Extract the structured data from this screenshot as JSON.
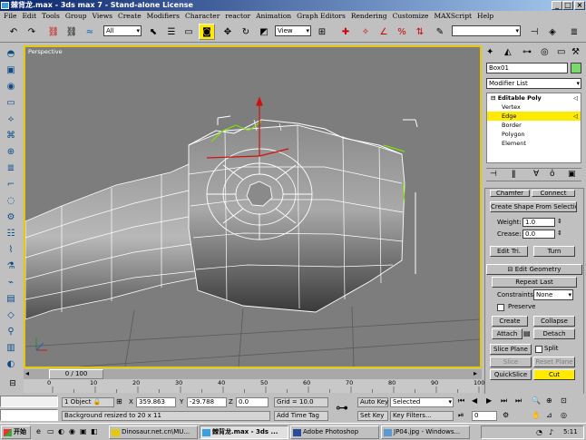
{
  "window": {
    "title": "棘背龙.max - 3ds max 7 - Stand-alone License",
    "min": "_",
    "max": "□",
    "close": "×"
  },
  "menu": [
    "File",
    "Edit",
    "Tools",
    "Group",
    "Views",
    "Create",
    "Modifiers",
    "Character",
    "reactor",
    "Animation",
    "Graph Editors",
    "Rendering",
    "Customize",
    "MAXScript",
    "Help"
  ],
  "toolbar": {
    "selection_filter": "All",
    "ref_coord": "View",
    "named_selection": ""
  },
  "viewport": {
    "label": "Perspective"
  },
  "panel": {
    "object_name": "Box01",
    "modifier_list": "Modifier List",
    "stack": {
      "root": "Editable Poly",
      "items": [
        "Vertex",
        "Edge",
        "Border",
        "Polygon",
        "Element"
      ],
      "active": "Edge"
    },
    "rollup_top": {
      "chamfer": "Chamfer",
      "connect": "Connect",
      "create_shape": "Create Shape From Selection",
      "weight_label": "Weight:",
      "weight_value": "1.0",
      "crease_label": "Crease:",
      "crease_value": "0.0",
      "edit_tri": "Edit Tri.",
      "turn": "Turn"
    },
    "edit_geometry": {
      "title": "Edit Geometry",
      "repeat_last": "Repeat Last",
      "constraints_label": "Constraints:",
      "constraints_value": "None",
      "preserve": "Preserve",
      "create": "Create",
      "collapse": "Collapse",
      "attach": "Attach",
      "detach": "Detach",
      "slice_plane": "Slice Plane",
      "split": "Split",
      "slice": "Slice",
      "reset_plane": "Reset Plane",
      "quickslice": "QuickSlice",
      "cut": "Cut"
    }
  },
  "timeline": {
    "frame": "0 / 100",
    "ticks": [
      "0",
      "10",
      "20",
      "30",
      "40",
      "50",
      "60",
      "70",
      "80",
      "90",
      "100"
    ]
  },
  "status": {
    "selected": "1 Object",
    "x_label": "X",
    "x_value": "359.863",
    "y_label": "Y",
    "y_value": "-29.788",
    "z_label": "Z",
    "z_value": "0.0",
    "grid": "Grid = 10.0",
    "prompt": "Background resized to 20 x 11",
    "add_time_tag": "Add Time Tag",
    "auto_key": "Auto Key",
    "set_key": "Set Key",
    "selected_dropdown": "Selected",
    "key_filters": "Key Filters...",
    "frame_field": "0"
  },
  "taskbar": {
    "start": "开始",
    "tasks": [
      "Dinosaur.net.cn\\MU...",
      "棘背龙.max - 3ds ...",
      "Adobe Photoshop",
      "JP04.jpg - Windows..."
    ],
    "clock": "5:11"
  },
  "colors": {
    "title_start": "#08246b",
    "selection_active": "#ffea00",
    "viewport_border": "#e8c800",
    "viewport_bg": "#7d7d7d"
  }
}
